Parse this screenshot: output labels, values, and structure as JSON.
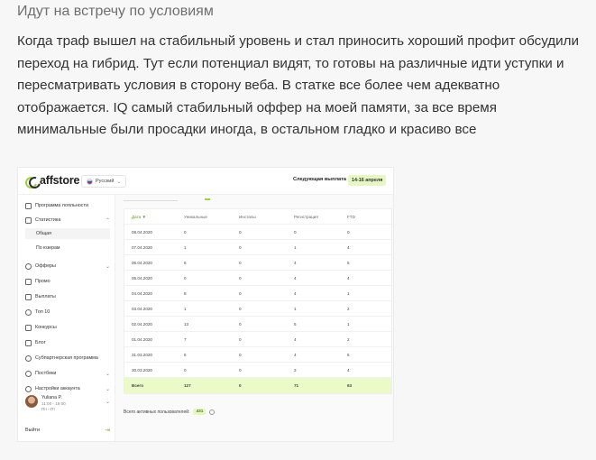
{
  "article": {
    "heading": "Идут на встречу по условиям",
    "paragraph": "Когда траф вышел на стабильный уровень и стал приносить хороший профит обсудили переход на гибрид. Тут если потенциал видят, то готовы на различные идти уступки и пересматривать условия в сторону веба. В статке все более чем адекватно отображается. IQ самый стабильный оффер на моей памяти, за все время минимальные были просадки иногда, в остальном гладко и красиво все"
  },
  "app": {
    "logo": "affstore",
    "language": "Русский",
    "payout_label": "Следующая выплата",
    "payout_dates": "14-16 апреля",
    "sidebar": {
      "loyalty": "Программа лояльности",
      "statistics": "Статистика",
      "sub_general": "Общая",
      "sub_by_users": "По юзерам",
      "offers": "Офферы",
      "promo": "Промо",
      "payouts": "Выплаты",
      "top10": "Топ 10",
      "contests": "Конкурсы",
      "blog": "Блог",
      "partner_program": "Субпартнерская программа",
      "postbacks": "Постбеки",
      "account_settings": "Настройки аккаунта",
      "user_name": "Yuliana P.",
      "user_hours": "11:00 - 19:00",
      "user_days": "Пн - Пт",
      "logout": "Выйти"
    },
    "table": {
      "headers": [
        "Дата ▼",
        "Уникальные",
        "Инсталы",
        "Регистрация",
        "FTD"
      ],
      "rows": [
        [
          "08.04.2020",
          "0",
          "0",
          "0",
          "0"
        ],
        [
          "07.04.2020",
          "1",
          "0",
          "1",
          "4"
        ],
        [
          "06.04.2020",
          "6",
          "0",
          "4",
          "5"
        ],
        [
          "05.04.2020",
          "0",
          "0",
          "4",
          "4"
        ],
        [
          "04.04.2020",
          "8",
          "0",
          "4",
          "1"
        ],
        [
          "03.04.2020",
          "1",
          "0",
          "1",
          "2"
        ],
        [
          "02.04.2020",
          "13",
          "0",
          "5",
          "1"
        ],
        [
          "01.04.2020",
          "7",
          "0",
          "4",
          "2"
        ],
        [
          "31.03.2020",
          "6",
          "0",
          "4",
          "5"
        ],
        [
          "30.03.2020",
          "0",
          "0",
          "3",
          "4"
        ]
      ],
      "total": [
        "Всего",
        "127",
        "0",
        "71",
        "63"
      ]
    },
    "footer_label": "Всего активных пользователей:",
    "footer_count": "431"
  }
}
